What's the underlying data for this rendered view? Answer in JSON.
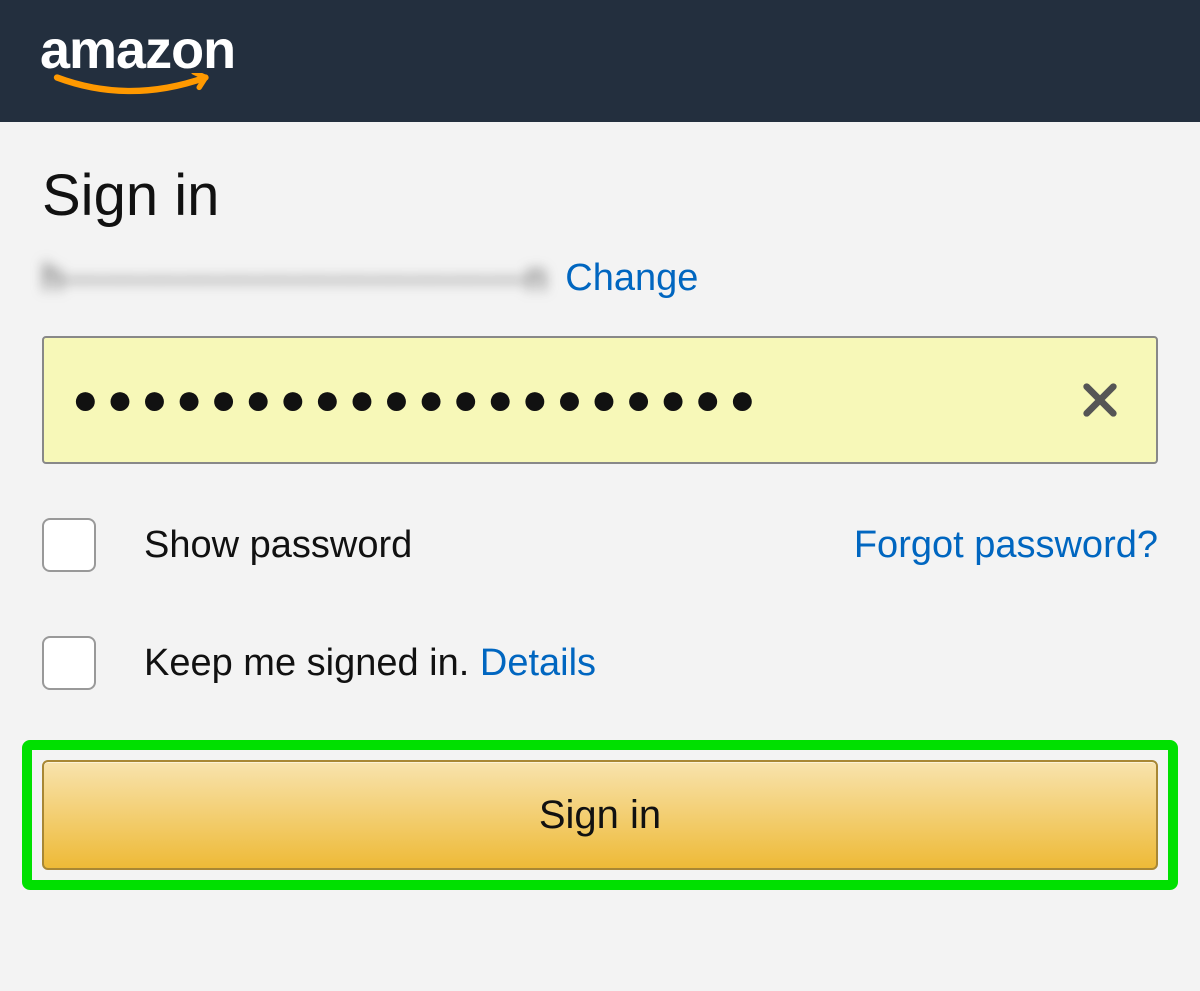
{
  "header": {
    "logo_text": "amazon"
  },
  "signin": {
    "title": "Sign in",
    "email_masked": "h————————————n",
    "change_link": "Change",
    "password_value": "●●●●●●●●●●●●●●●●●●●●",
    "show_password_label": "Show password",
    "forgot_password_link": "Forgot password?",
    "keep_signed_in_label": "Keep me signed in. ",
    "details_link": "Details",
    "signin_button_label": "Sign in"
  },
  "colors": {
    "header_bg": "#232f3e",
    "link": "#0066c0",
    "button_gradient_top": "#f8e3ad",
    "button_gradient_bottom": "#eeba37",
    "highlight_border": "#00e000",
    "input_bg": "#f7f8b8"
  }
}
